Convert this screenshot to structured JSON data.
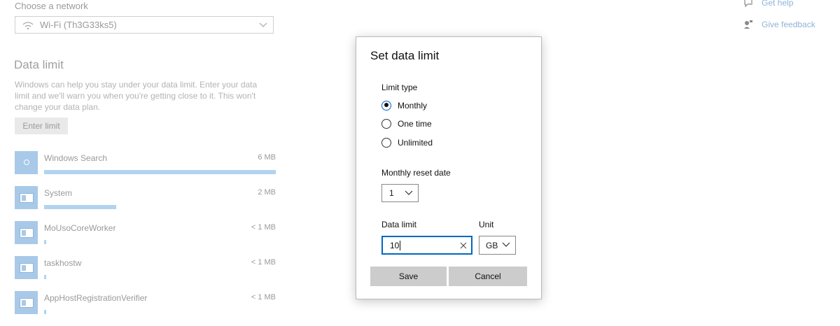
{
  "network": {
    "label": "Choose a network",
    "selected": "Wi-Fi (Th3G33ks5)"
  },
  "data_limit_section": {
    "title": "Data limit",
    "description": "Windows can help you stay under your data limit. Enter your data limit and we'll warn you when you're getting close to it. This won't change your data plan.",
    "enter_limit_label": "Enter limit"
  },
  "apps": [
    {
      "name": "Windows Search",
      "size": "6 MB",
      "usage_fraction": 1.0,
      "icon": "search-icon"
    },
    {
      "name": "System",
      "size": "2 MB",
      "usage_fraction": 0.31,
      "icon": "app-window-icon"
    },
    {
      "name": "MoUsoCoreWorker",
      "size": "< 1 MB",
      "usage_fraction": 0.01,
      "icon": "app-window-icon"
    },
    {
      "name": "taskhostw",
      "size": "< 1 MB",
      "usage_fraction": 0.01,
      "icon": "app-window-icon"
    },
    {
      "name": "AppHostRegistrationVerifier",
      "size": "< 1 MB",
      "usage_fraction": 0.01,
      "icon": "app-window-icon"
    }
  ],
  "help_links": {
    "get_help": "Get help",
    "give_feedback": "Give feedback"
  },
  "dialog": {
    "title": "Set data limit",
    "limit_type_label": "Limit type",
    "options": [
      {
        "label": "Monthly",
        "selected": true
      },
      {
        "label": "One time",
        "selected": false
      },
      {
        "label": "Unlimited",
        "selected": false
      }
    ],
    "reset_date_label": "Monthly reset date",
    "reset_date_value": "1",
    "data_limit_label": "Data limit",
    "data_limit_value": "10",
    "unit_label": "Unit",
    "unit_value": "GB",
    "save_label": "Save",
    "cancel_label": "Cancel"
  },
  "colors": {
    "accent": "#0067c0",
    "usage_bar": "#b0d3f0",
    "button": "#cccccc"
  }
}
